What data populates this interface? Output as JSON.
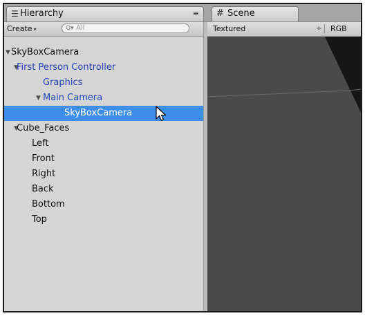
{
  "hierarchy": {
    "tab_icon": "list-icon",
    "tab_label": "Hierarchy",
    "tab_menu_icon": "≡",
    "create_label": "Create",
    "create_arrow": "▾",
    "search_icon": "Q▾",
    "search_placeholder": "All",
    "items": [
      {
        "label": "SkyBoxCamera",
        "depth": 0,
        "expanded": true,
        "color": "#111111"
      },
      {
        "label": "First Person Controller",
        "depth": 1,
        "expanded": true,
        "color": "#2341b8"
      },
      {
        "label": "Graphics",
        "depth": 2,
        "expanded": null,
        "color": "#2341b8"
      },
      {
        "label": "Main Camera",
        "depth": 2,
        "expanded": true,
        "color": "#2341b8"
      },
      {
        "label": "SkyBoxCamera",
        "depth": 3,
        "expanded": null,
        "color": "#ffffff",
        "selected": true
      },
      {
        "label": "Cube_Faces",
        "depth": 1,
        "expanded": true,
        "color": "#111111"
      },
      {
        "label": "Left",
        "depth": 2,
        "expanded": null,
        "color": "#111111"
      },
      {
        "label": "Front",
        "depth": 2,
        "expanded": null,
        "color": "#111111"
      },
      {
        "label": "Right",
        "depth": 2,
        "expanded": null,
        "color": "#111111"
      },
      {
        "label": "Back",
        "depth": 2,
        "expanded": null,
        "color": "#111111"
      },
      {
        "label": "Bottom",
        "depth": 2,
        "expanded": null,
        "color": "#111111"
      },
      {
        "label": "Top",
        "depth": 2,
        "expanded": null,
        "color": "#111111"
      }
    ]
  },
  "scene": {
    "tab_icon": "#",
    "tab_label": "Scene",
    "shading_mode": "Textured",
    "shading_arrow": "÷",
    "render_mode": "RGB"
  },
  "colors": {
    "selection": "#3d8ee8",
    "prefab_blue": "#2341b8",
    "scene_bg": "#4a4a4a"
  }
}
